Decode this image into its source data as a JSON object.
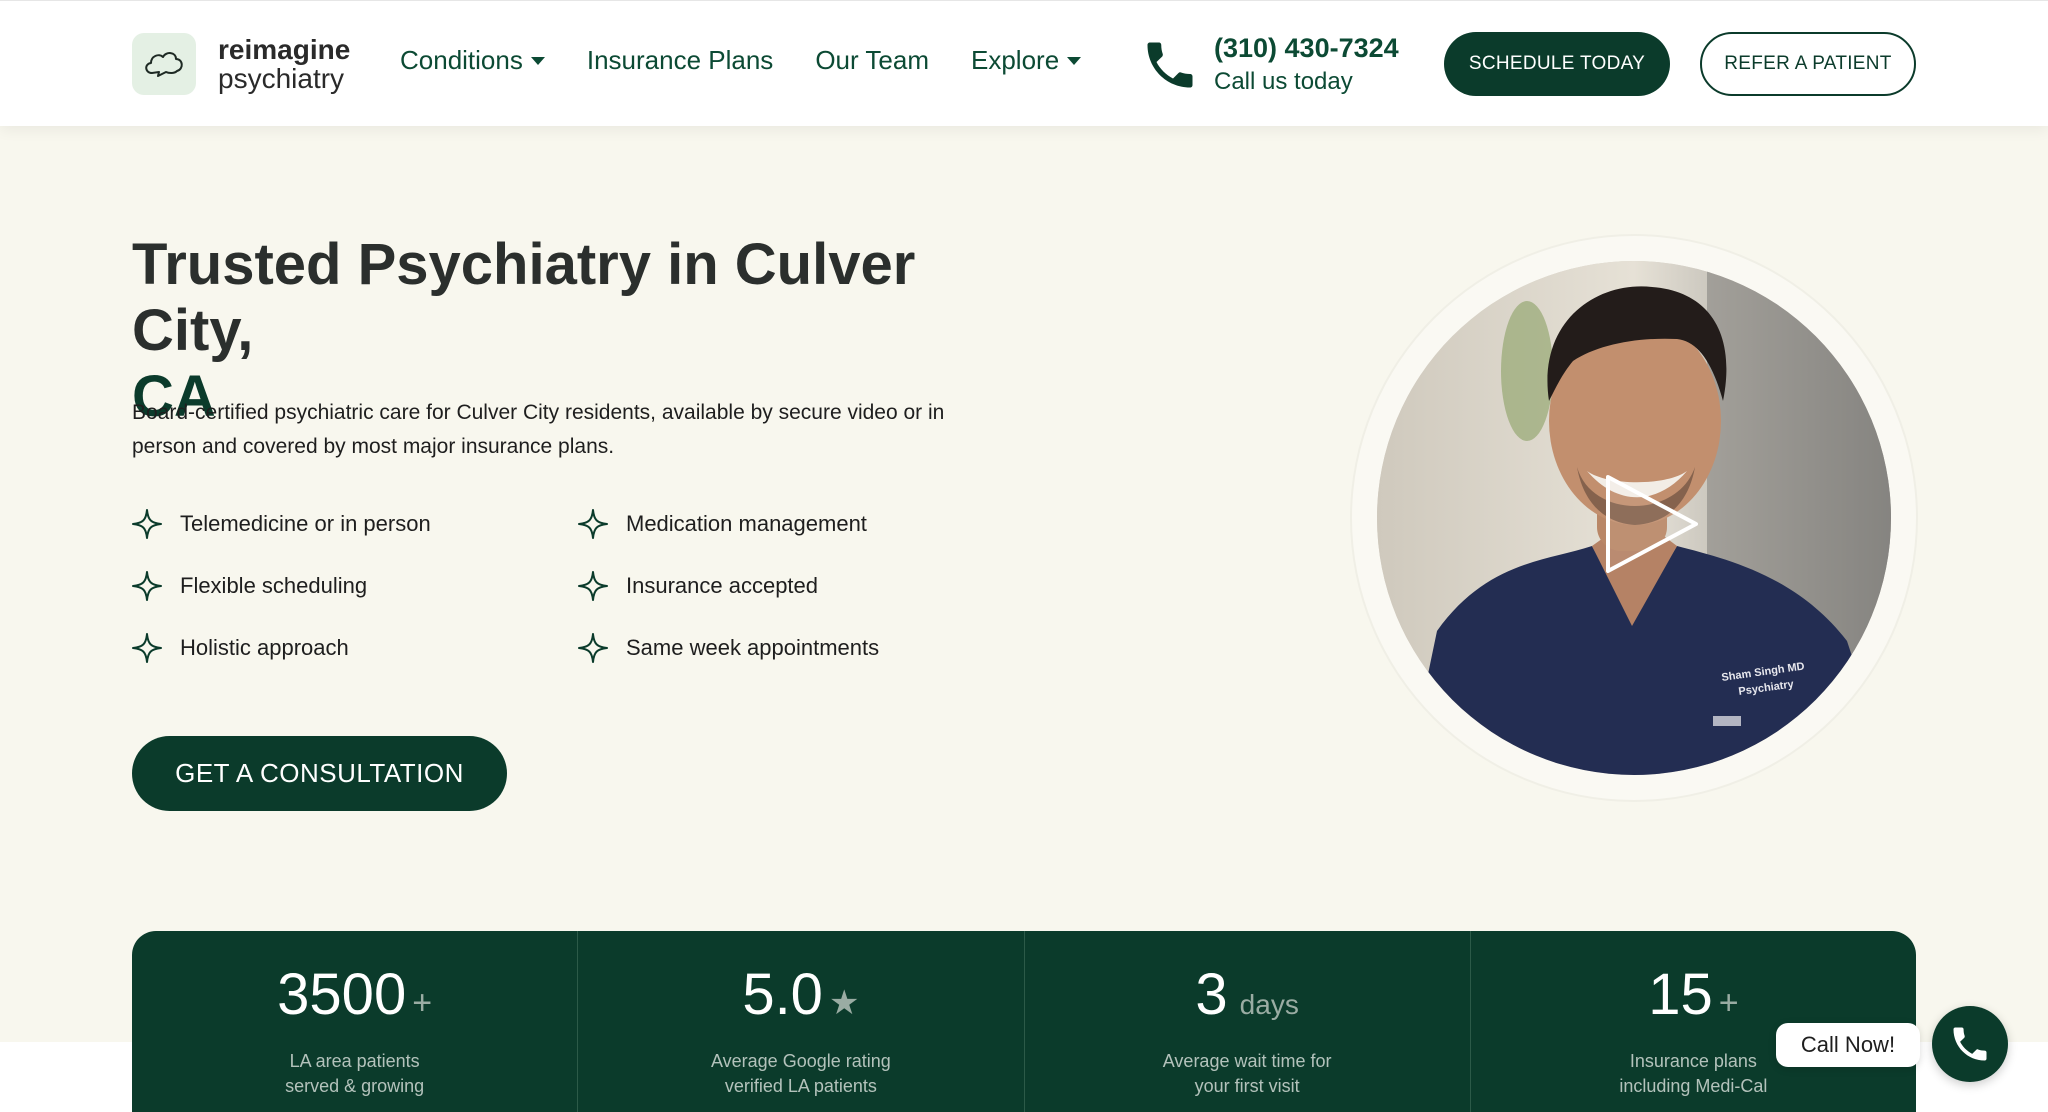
{
  "header": {
    "logo": {
      "line1": "reimagine",
      "line2": "psychiatry",
      "icon": "cloud-icon"
    },
    "nav": [
      {
        "label": "Conditions",
        "has_dropdown": true
      },
      {
        "label": "Insurance Plans",
        "has_dropdown": false
      },
      {
        "label": "Our Team",
        "has_dropdown": false
      },
      {
        "label": "Explore",
        "has_dropdown": true
      }
    ],
    "phone": {
      "number": "(310) 430-7324",
      "subtitle": "Call us today",
      "icon": "phone-icon"
    },
    "schedule_label": "SCHEDULE TODAY",
    "refer_label": "REFER A PATIENT"
  },
  "hero": {
    "title_main": "Trusted Psychiatry in Culver City,",
    "title_accent": "CA",
    "description": "Board-certified psychiatric care for Culver City residents, available by secure video or in person and covered by most major insurance plans.",
    "features": [
      "Telemedicine or in person",
      "Medication management",
      "Flexible scheduling",
      "Insurance accepted",
      "Holistic approach",
      "Same week appointments"
    ],
    "cta_label": "GET A CONSULTATION",
    "video": {
      "badge_name": "Sham Singh MD",
      "badge_role": "Psychiatry",
      "icon": "play-icon"
    }
  },
  "stats": [
    {
      "value": "3500",
      "suffix": "+",
      "label_line1": "LA area patients",
      "label_line2": "served & growing"
    },
    {
      "value": "5.0",
      "suffix": "★",
      "label_line1": "Average Google rating",
      "label_line2": "verified LA patients"
    },
    {
      "value": "3",
      "suffix": "days",
      "label_line1": "Average wait time for",
      "label_line2": "your first visit"
    },
    {
      "value": "15",
      "suffix": "+",
      "label_line1": "Insurance plans",
      "label_line2": "including Medi-Cal"
    }
  ],
  "call_widget": {
    "label": "Call Now!",
    "icon": "phone-icon"
  },
  "colors": {
    "brand_green": "#0b3b2b",
    "background": "#f8f7ee",
    "accent_text": "#0c4a34"
  }
}
